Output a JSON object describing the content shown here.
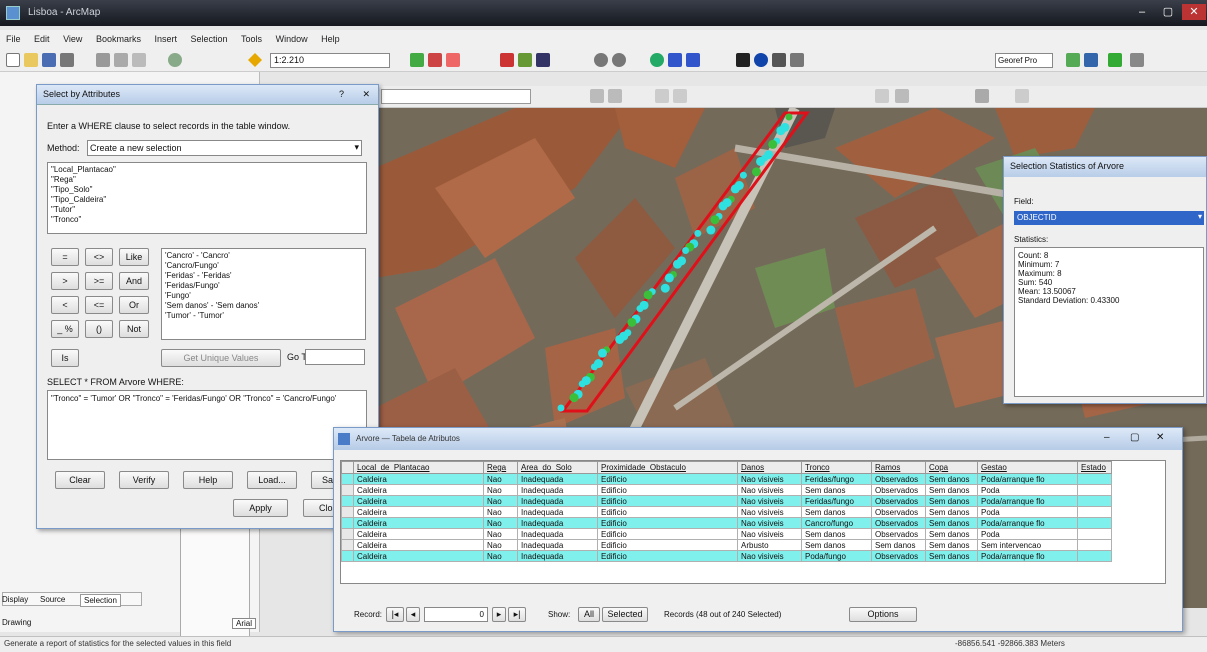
{
  "window": {
    "title": "Lisboa - ArcMap",
    "controls": [
      "–",
      "▢",
      "✕"
    ]
  },
  "menu": [
    "File",
    "Edit",
    "View",
    "Bookmarks",
    "Insert",
    "Selection",
    "Tools",
    "Window",
    "Help"
  ],
  "toolbar": {
    "scale_value": "1:2.210",
    "spatial_label": "Georef Pro"
  },
  "left_panel": {
    "tabs": [
      "Display",
      "Source",
      "Selection"
    ],
    "drawing_label": "Drawing",
    "font_value": "Arial"
  },
  "select_dialog": {
    "title": "Select by Attributes",
    "prompt": "Enter a WHERE clause to select records in the table window.",
    "method_label": "Method:",
    "method_value": "Create a new selection",
    "fields": [
      "\"Local_Plantacao\"",
      "\"Rega\"",
      "\"Tipo_Solo\"",
      "\"Tipo_Caldeira\"",
      "\"Tutor\"",
      "\"Tronco\""
    ],
    "values": [
      "'Cancro' - 'Cancro'",
      "'Cancro/Fungo'",
      "'Feridas' - 'Feridas'",
      "'Feridas/Fungo'",
      "'Fungo'",
      "'Sem danos' - 'Sem danos'",
      "'Tumor' - 'Tumor'"
    ],
    "operators": [
      "=",
      "<>",
      "Like",
      ">",
      ">=",
      "And",
      "<",
      "<=",
      "Or",
      "_ %",
      "()",
      "Not",
      "Is"
    ],
    "get_unique_label": "Get Unique Values",
    "go_to_label": "Go To:",
    "sql_label": "SELECT * FROM Arvore WHERE:",
    "expression": "\"Tronco\" = 'Tumor' OR \"Tronco\" = 'Feridas/Fungo' OR \"Tronco\" = 'Cancro/Fungo'",
    "buttons": {
      "clear": "Clear",
      "verify": "Verify",
      "help": "Help",
      "load": "Load...",
      "save": "Save...",
      "apply": "Apply",
      "close": "Close"
    }
  },
  "stats_dialog": {
    "title": "Selection Statistics of Arvore",
    "field_label": "Field:",
    "field_value": "OBJECTID",
    "statistics_label": "Statistics:",
    "stats": [
      {
        "k": "Count:",
        "v": "8"
      },
      {
        "k": "Minimum:",
        "v": "7"
      },
      {
        "k": "Maximum:",
        "v": "8"
      },
      {
        "k": "Sum:",
        "v": "540"
      },
      {
        "k": "Mean:",
        "v": "13.50067"
      },
      {
        "k": "Standard Deviation:",
        "v": "0.43300"
      }
    ]
  },
  "table": {
    "title": "Arvore — Tabela de Atributos",
    "columns": [
      "Local_de_Plantacao",
      "Rega",
      "Area_do_Solo",
      "Proximidade_Obstaculo",
      "Danos",
      "Tronco",
      "Ramos",
      "Copa",
      "Gestao",
      "Estado"
    ],
    "rows": [
      {
        "sel": true,
        "cells": [
          "Caldeira",
          "Nao",
          "Inadequada",
          "Edificio",
          "Nao visiveis",
          "Feridas/fungo",
          "Observados",
          "Sem danos",
          "Poda/arranque flo",
          ""
        ]
      },
      {
        "sel": false,
        "cells": [
          "Caldeira",
          "Nao",
          "Inadequada",
          "Edificio",
          "Nao visiveis",
          "Sem danos",
          "Observados",
          "Sem danos",
          "Poda",
          ""
        ]
      },
      {
        "sel": true,
        "cells": [
          "Caldeira",
          "Nao",
          "Inadequada",
          "Edificio",
          "Nao visiveis",
          "Feridas/fungo",
          "Observados",
          "Sem danos",
          "Poda/arranque flo",
          ""
        ]
      },
      {
        "sel": false,
        "cells": [
          "Caldeira",
          "Nao",
          "Inadequada",
          "Edificio",
          "Nao visiveis",
          "Sem danos",
          "Observados",
          "Sem danos",
          "Poda",
          ""
        ]
      },
      {
        "sel": true,
        "cells": [
          "Caldeira",
          "Nao",
          "Inadequada",
          "Edificio",
          "Nao visiveis",
          "Cancro/fungo",
          "Observados",
          "Sem danos",
          "Poda/arranque flo",
          ""
        ]
      },
      {
        "sel": false,
        "cells": [
          "Caldeira",
          "Nao",
          "Inadequada",
          "Edificio",
          "Nao visiveis",
          "Sem danos",
          "Observados",
          "Sem danos",
          "Poda",
          ""
        ]
      },
      {
        "sel": false,
        "cells": [
          "Caldeira",
          "Nao",
          "Inadequada",
          "Edificio",
          "Arbusto",
          "Sem danos",
          "Sem danos",
          "Sem danos",
          "Sem intervencao",
          ""
        ]
      },
      {
        "sel": true,
        "cells": [
          "Caldeira",
          "Nao",
          "Inadequada",
          "Edificio",
          "Nao visiveis",
          "Poda/fungo",
          "Observados",
          "Sem danos",
          "Poda/arranque flo",
          ""
        ]
      }
    ],
    "footer": {
      "record_label": "Record:",
      "record_value": "0",
      "show_label": "Show:",
      "all_label": "All",
      "selected_label": "Selected",
      "records_text": "Records (48 out of 240 Selected)",
      "options_label": "Options"
    }
  },
  "status": {
    "left": "Generate a report of statistics for the selected values in this field",
    "right": "-86856.541  -92866.383 Meters"
  },
  "colors": {
    "selected_row": "#7ff0ec",
    "map_points": "#2fe0e0",
    "selection_outline": "#e0101a"
  }
}
